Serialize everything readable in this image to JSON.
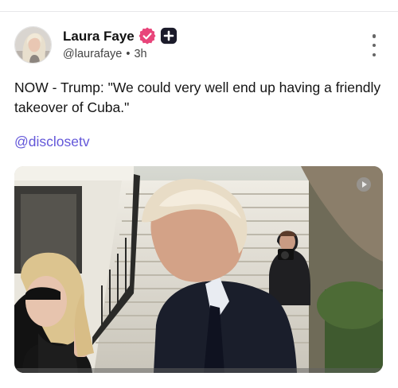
{
  "post": {
    "author": {
      "name": "Laura Faye",
      "handle": "@laurafaye",
      "time": "3h",
      "separator": "•",
      "verified_badge": "verified-badge-icon",
      "secondary_badge": "plus-badge-icon"
    },
    "text": "NOW - Trump: \"We could very well end up having a friendly takeover of Cuba.\"",
    "link": "@disclosetv",
    "menu_icon": "more-vertical-icon",
    "media": {
      "kind": "video",
      "control_icon": "play-icon"
    }
  },
  "colors": {
    "verified": "#e8457a",
    "link": "#6357d9",
    "menu": "#666666",
    "divider": "#e7e7ea"
  }
}
